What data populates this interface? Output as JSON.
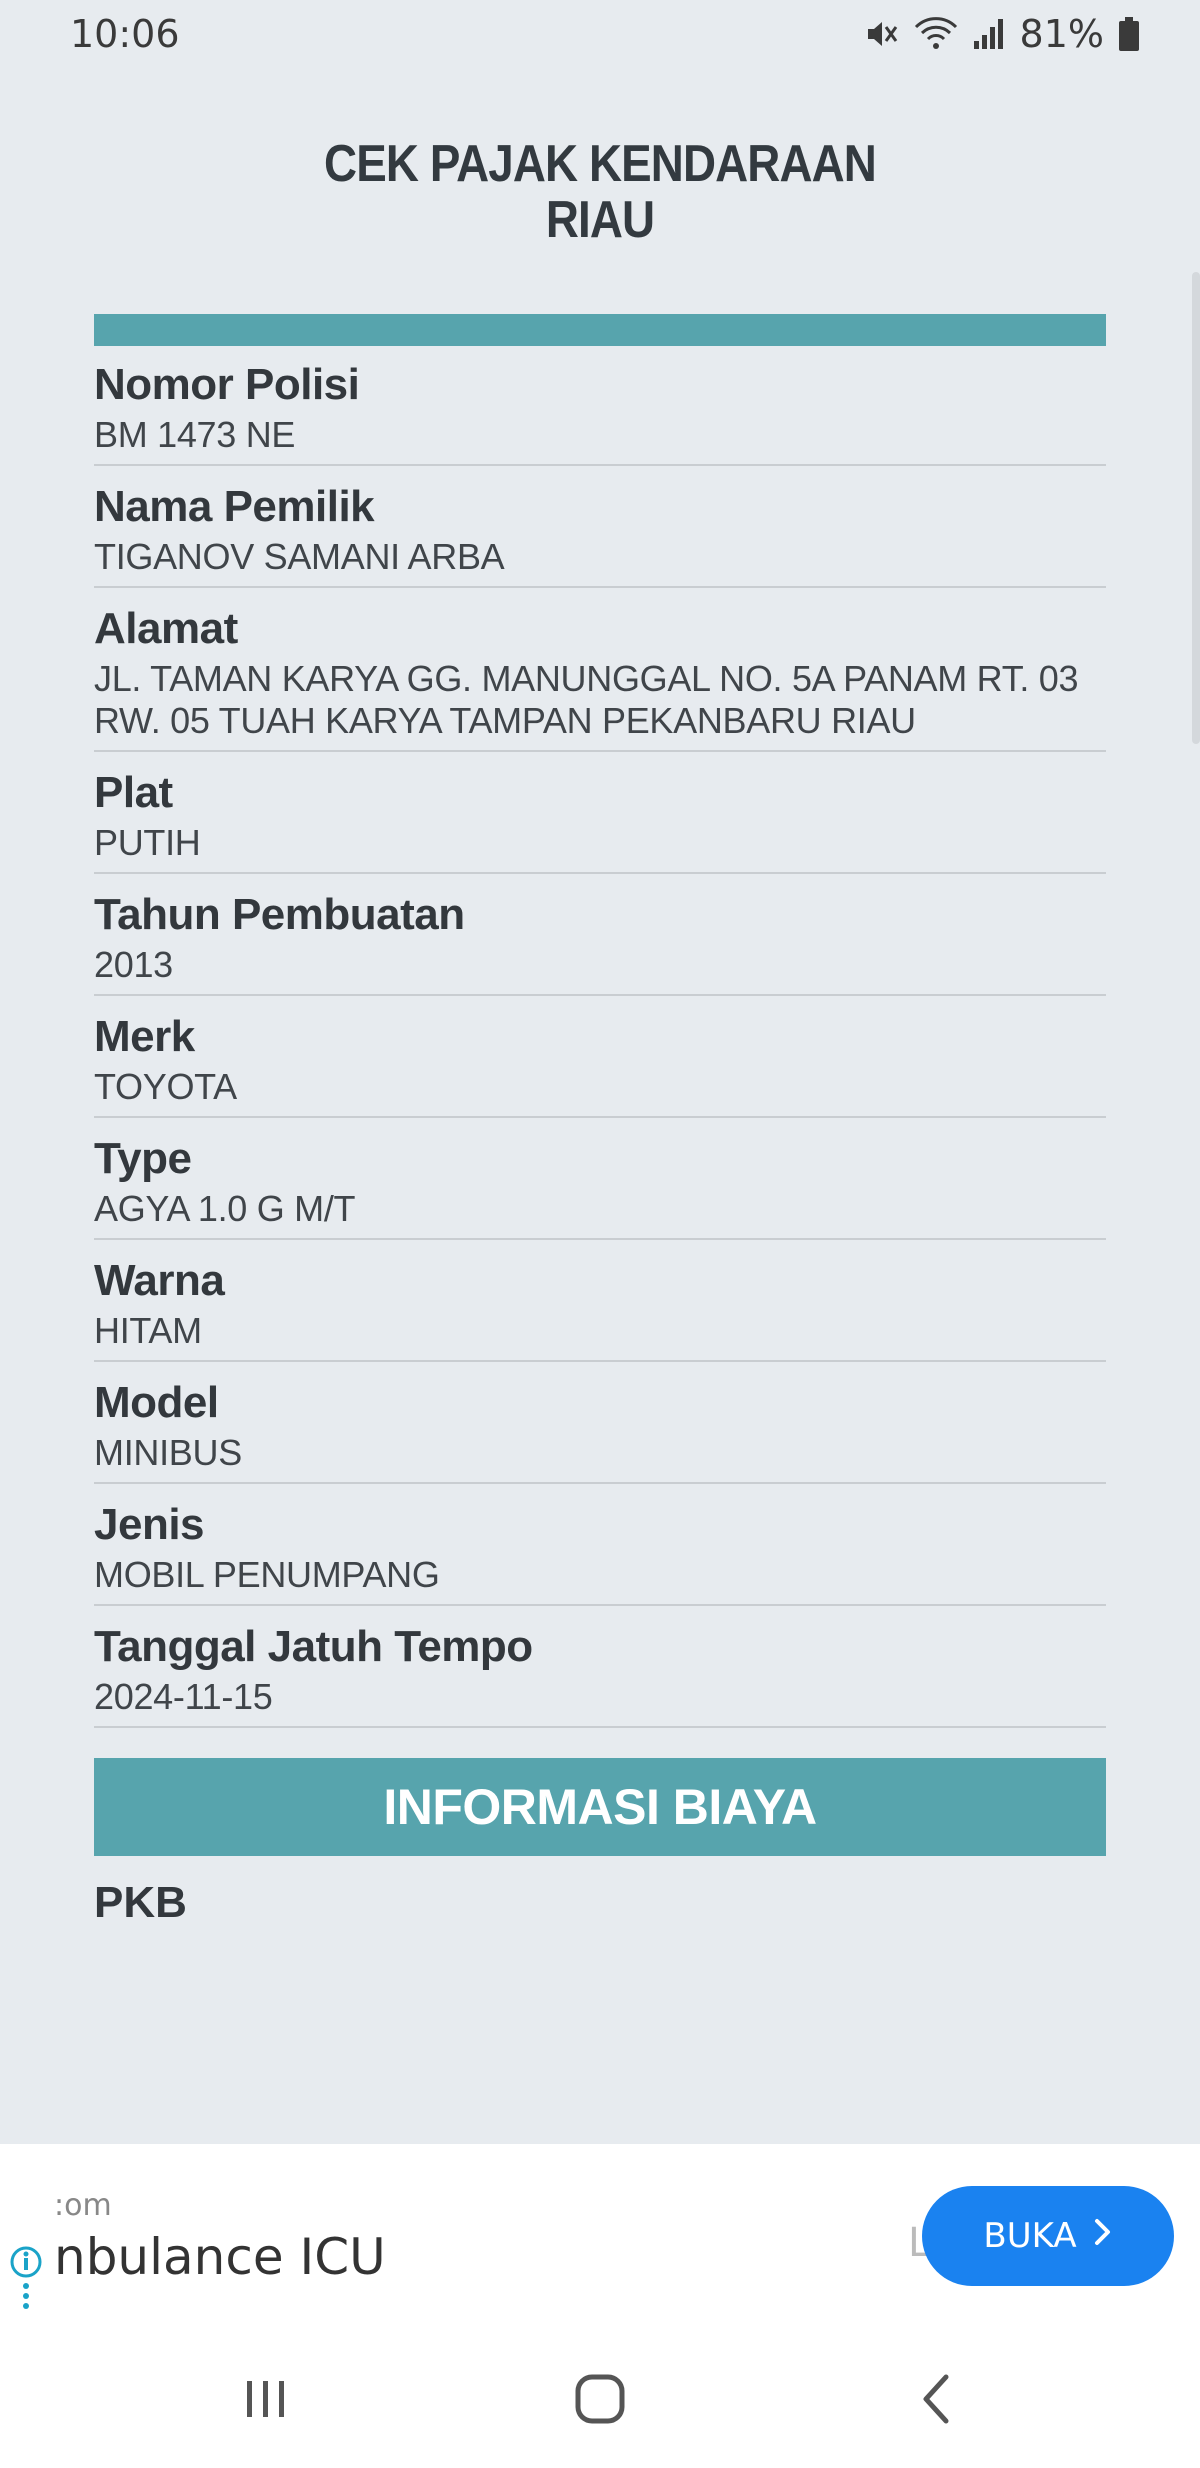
{
  "status_bar": {
    "time": "10:06",
    "battery": "81%"
  },
  "app": {
    "title_line1": "CEK PAJAK KENDARAAN",
    "title_line2": "RIAU"
  },
  "vehicle_info": {
    "fields": [
      {
        "label": "Nomor Polisi",
        "value": "BM 1473 NE"
      },
      {
        "label": "Nama Pemilik",
        "value": "TIGANOV SAMANI ARBA"
      },
      {
        "label": "Alamat",
        "value": "JL. TAMAN KARYA GG. MANUNGGAL NO. 5A PANAM RT. 03 RW. 05 TUAH KARYA TAMPAN PEKANBARU RIAU"
      },
      {
        "label": "Plat",
        "value": "PUTIH"
      },
      {
        "label": "Tahun Pembuatan",
        "value": "2013"
      },
      {
        "label": "Merk",
        "value": "TOYOTA"
      },
      {
        "label": "Type",
        "value": "AGYA 1.0 G M/T"
      },
      {
        "label": "Warna",
        "value": "HITAM"
      },
      {
        "label": "Model",
        "value": "MINIBUS"
      },
      {
        "label": "Jenis",
        "value": "MOBIL PENUMPANG"
      },
      {
        "label": "Tanggal Jatuh Tempo",
        "value": "2024-11-15"
      }
    ]
  },
  "cost_info": {
    "header": "INFORMASI BIAYA",
    "first_label_partial": "PKB"
  },
  "ad": {
    "domain": ":om",
    "title": "nbulance ICU",
    "hidden_letter": "L",
    "button_label": "BUKA"
  },
  "colors": {
    "accent": "#57a4ad",
    "background": "#e7ebef",
    "ad_button": "#1a82f0"
  }
}
